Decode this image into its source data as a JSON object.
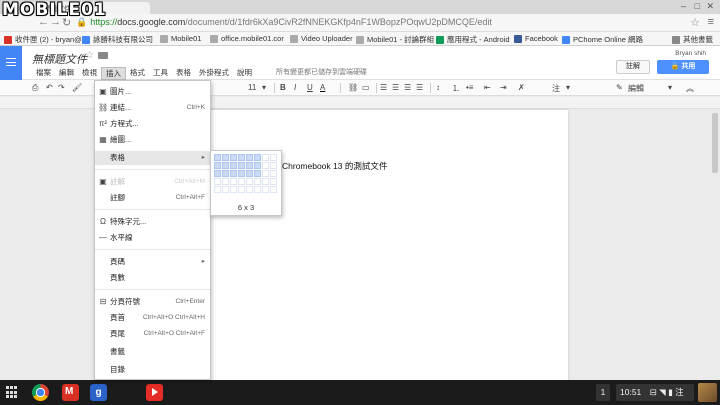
{
  "watermark": "MOBILE01",
  "browser": {
    "tab_title": "無標題文件",
    "url_scheme": "https://",
    "url_host": "docs.google.com",
    "url_path": "/document/d/1fdr6kXa9CivR2fNNEKGKfp4nF1WBopzPOqwU2pDMCQE/edit",
    "bookmarks": [
      {
        "label": "收件匣 (2) - bryan@",
        "icon": "gmail-icon",
        "color": "#d93025"
      },
      {
        "label": "詠勝科技有限公司",
        "icon": "calendar-icon",
        "color": "#4285f4"
      },
      {
        "label": "Mobile01",
        "icon": "page-icon",
        "color": "#999999"
      },
      {
        "label": "office.mobile01.cor",
        "icon": "page-icon",
        "color": "#999999"
      },
      {
        "label": "Video Uploader",
        "icon": "page-icon",
        "color": "#999999"
      },
      {
        "label": "Mobile01 - 討論群組",
        "icon": "page-icon",
        "color": "#999999"
      },
      {
        "label": "應用程式 - Android",
        "icon": "play-icon",
        "color": "#0f9d58"
      },
      {
        "label": "Facebook",
        "icon": "facebook-icon",
        "color": "#3b5998"
      },
      {
        "label": "PChome Online 網路",
        "icon": "page-icon",
        "color": "#4285f4"
      }
    ],
    "other_bookmarks": "其他書籤"
  },
  "docs": {
    "title": "無標題文件",
    "menus": [
      "檔案",
      "編輯",
      "檢視",
      "插入",
      "格式",
      "工具",
      "表格",
      "外掛程式",
      "說明"
    ],
    "active_menu": "插入",
    "save_status": "所有變更都已儲存到雲端硬碟",
    "user": "Bryan shih",
    "comment_label": "註解",
    "share_label": "共用",
    "toolbar": {
      "font_size": "11",
      "bold": "B",
      "italic": "I",
      "underline": "U",
      "text_color": "A",
      "bulleted_label": "注",
      "editing_label": "編輯"
    },
    "document_text": "Chromebook 13 的測試文件"
  },
  "insert_menu": {
    "items": [
      {
        "label": "圖片...",
        "icon": "image-icon",
        "shortcut": "",
        "disabled": false,
        "submenu": false
      },
      {
        "label": "連結...",
        "icon": "link-icon",
        "shortcut": "Ctrl+K",
        "disabled": false,
        "submenu": false
      },
      {
        "label": "方程式...",
        "icon": "equation-icon",
        "shortcut": "",
        "disabled": false,
        "submenu": false
      },
      {
        "label": "繪圖...",
        "icon": "drawing-icon",
        "shortcut": "",
        "disabled": false,
        "submenu": false
      },
      {
        "label": "表格",
        "icon": "",
        "shortcut": "",
        "disabled": false,
        "submenu": true,
        "highlighted": true
      },
      {
        "label": "註解",
        "icon": "comment-icon",
        "shortcut": "Ctrl+Alt+M",
        "disabled": true,
        "submenu": false
      },
      {
        "label": "註腳",
        "icon": "",
        "shortcut": "Ctrl+Alt+F",
        "disabled": false,
        "submenu": false
      },
      {
        "label": "特殊字元...",
        "icon": "omega-icon",
        "shortcut": "",
        "disabled": false,
        "submenu": false
      },
      {
        "label": "水平線",
        "icon": "horizontal-line-icon",
        "shortcut": "",
        "disabled": false,
        "submenu": false
      },
      {
        "label": "頁碼",
        "icon": "",
        "shortcut": "",
        "disabled": false,
        "submenu": true
      },
      {
        "label": "頁數",
        "icon": "",
        "shortcut": "",
        "disabled": false,
        "submenu": false
      },
      {
        "label": "分頁符號",
        "icon": "page-break-icon",
        "shortcut": "Ctrl+Enter",
        "disabled": false,
        "submenu": false
      },
      {
        "label": "頁首",
        "icon": "",
        "shortcut": "Ctrl+Alt+O Ctrl+Alt+H",
        "disabled": false,
        "submenu": false
      },
      {
        "label": "頁尾",
        "icon": "",
        "shortcut": "Ctrl+Alt+O Ctrl+Alt+F",
        "disabled": false,
        "submenu": false
      },
      {
        "label": "書籤",
        "icon": "",
        "shortcut": "",
        "disabled": false,
        "submenu": false
      },
      {
        "label": "目錄",
        "icon": "",
        "shortcut": "",
        "disabled": false,
        "submenu": false
      }
    ]
  },
  "table_picker": {
    "size_label": "6 x 3",
    "cols_selected": 6,
    "rows_selected": 3,
    "total_cols": 8,
    "total_rows": 5
  },
  "shelf": {
    "apps": [
      "chrome-icon",
      "gmail-icon",
      "google-plus-icon",
      "youtube-icon"
    ],
    "notification_count": "1",
    "time": "10:51",
    "ime_label": "注"
  }
}
